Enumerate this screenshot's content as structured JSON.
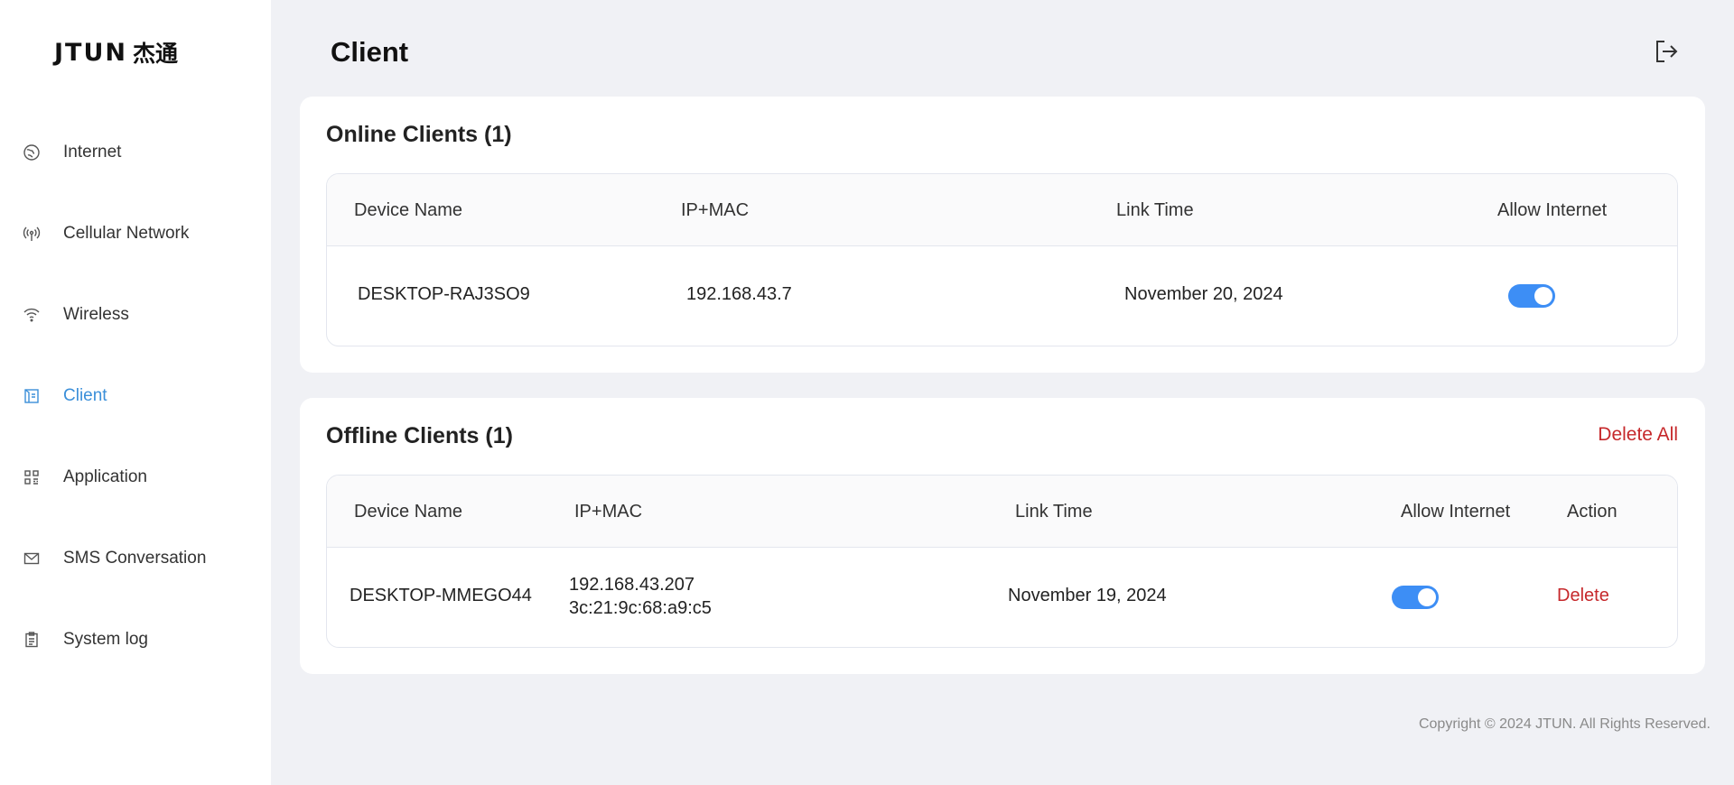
{
  "brand": {
    "logo_latin": "JTUN",
    "logo_cjk": "杰通"
  },
  "sidebar": {
    "items": [
      {
        "label": "Internet",
        "icon": "globe-icon",
        "active": false
      },
      {
        "label": "Cellular Network",
        "icon": "antenna-icon",
        "active": false
      },
      {
        "label": "Wireless",
        "icon": "wifi-icon",
        "active": false
      },
      {
        "label": "Client",
        "icon": "client-device-icon",
        "active": true
      },
      {
        "label": "Application",
        "icon": "grid-apps-icon",
        "active": false
      },
      {
        "label": "SMS Conversation",
        "icon": "envelope-icon",
        "active": false
      },
      {
        "label": "System log",
        "icon": "clipboard-log-icon",
        "active": false
      }
    ]
  },
  "header": {
    "title": "Client",
    "logout_icon": "logout-icon"
  },
  "online": {
    "title": "Online Clients (1)",
    "columns": {
      "device": "Device Name",
      "ipmac": "IP+MAC",
      "link_time": "Link Time",
      "allow": "Allow Internet"
    },
    "rows": [
      {
        "device": "DESKTOP-RAJ3SO9",
        "ip": "192.168.43.7",
        "mac": "",
        "link_time": "November 20, 2024",
        "allow_internet": true
      }
    ]
  },
  "offline": {
    "title": "Offline Clients (1)",
    "delete_all": "Delete All",
    "columns": {
      "device": "Device Name",
      "ipmac": "IP+MAC",
      "link_time": "Link Time",
      "allow": "Allow Internet",
      "action": "Action"
    },
    "rows": [
      {
        "device": "DESKTOP-MMEGO44",
        "ip": "192.168.43.207",
        "mac": "3c:21:9c:68:a9:c5",
        "link_time": "November 19, 2024",
        "allow_internet": true,
        "action": "Delete"
      }
    ]
  },
  "footer": {
    "copyright": "Copyright © 2024 JTUN. All Rights Reserved."
  },
  "colors": {
    "accent": "#3b8fd9",
    "toggle_on": "#3d8ef5",
    "danger": "#c6282b",
    "background": "#f0f1f5"
  }
}
